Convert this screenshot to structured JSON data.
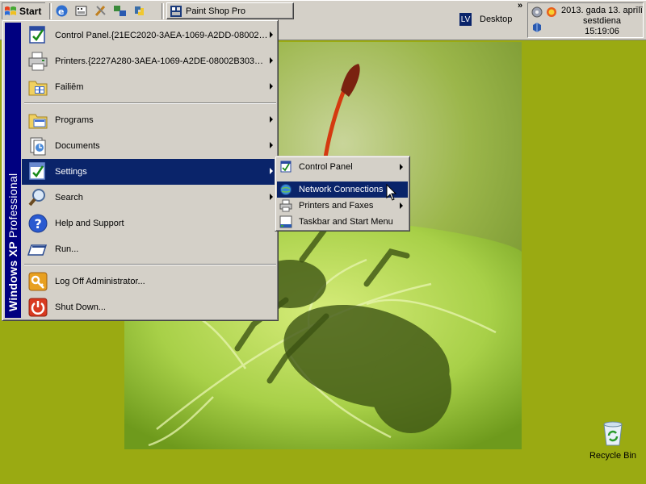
{
  "taskbar": {
    "start_label": "Start",
    "quick_launch": [
      "ie-icon",
      "media-icon",
      "tools-icon",
      "network-icon",
      "python-icon"
    ],
    "task_button": "Paint Shop Pro",
    "language": "LV",
    "desktop_toolbar": "Desktop",
    "chevron": "»",
    "clock": {
      "line1": "2013. gada 13. aprīlī",
      "line2": "sestdiena",
      "line3": "15:19:06"
    }
  },
  "start_menu": {
    "sidebar_bold": "Windows XP",
    "sidebar_thin": "Professional",
    "pinned": [
      {
        "label": "Control Panel.{21EC2020-3AEA-1069-A2DD-08002…",
        "icon": "control-panel-icon",
        "submenu": true
      },
      {
        "label": "Printers.{2227A280-3AEA-1069-A2DE-08002B303…",
        "icon": "printer-icon",
        "submenu": true
      },
      {
        "label": "Failiēm",
        "icon": "folder-icon",
        "submenu": true
      }
    ],
    "items": [
      {
        "label": "Programs",
        "icon": "programs-icon",
        "submenu": true
      },
      {
        "label": "Documents",
        "icon": "documents-icon",
        "submenu": true
      },
      {
        "label": "Settings",
        "icon": "settings-icon",
        "submenu": true,
        "selected": true
      },
      {
        "label": "Search",
        "icon": "search-icon",
        "submenu": true
      },
      {
        "label": "Help and Support",
        "icon": "help-icon",
        "submenu": false
      },
      {
        "label": "Run...",
        "icon": "run-icon",
        "submenu": false
      }
    ],
    "session": [
      {
        "label": "Log Off Administrator...",
        "icon": "key-icon"
      },
      {
        "label": "Shut Down...",
        "icon": "power-icon"
      }
    ]
  },
  "settings_submenu": [
    {
      "label": "Control Panel",
      "icon": "control-panel-icon",
      "submenu": true
    },
    {
      "label": "Network Connections",
      "icon": "network-connections-icon",
      "submenu": false,
      "selected": true
    },
    {
      "label": "Printers and Faxes",
      "icon": "printer-icon",
      "submenu": true
    },
    {
      "label": "Taskbar and Start Menu",
      "icon": "taskbar-icon",
      "submenu": false
    }
  ],
  "desktop": {
    "recycle_bin_label": "Recycle Bin"
  },
  "colors": {
    "desktop_bg": "#9aaa12",
    "menu_face": "#d4d0c8",
    "selection": "#0a246a",
    "sidebar": "#000080"
  }
}
